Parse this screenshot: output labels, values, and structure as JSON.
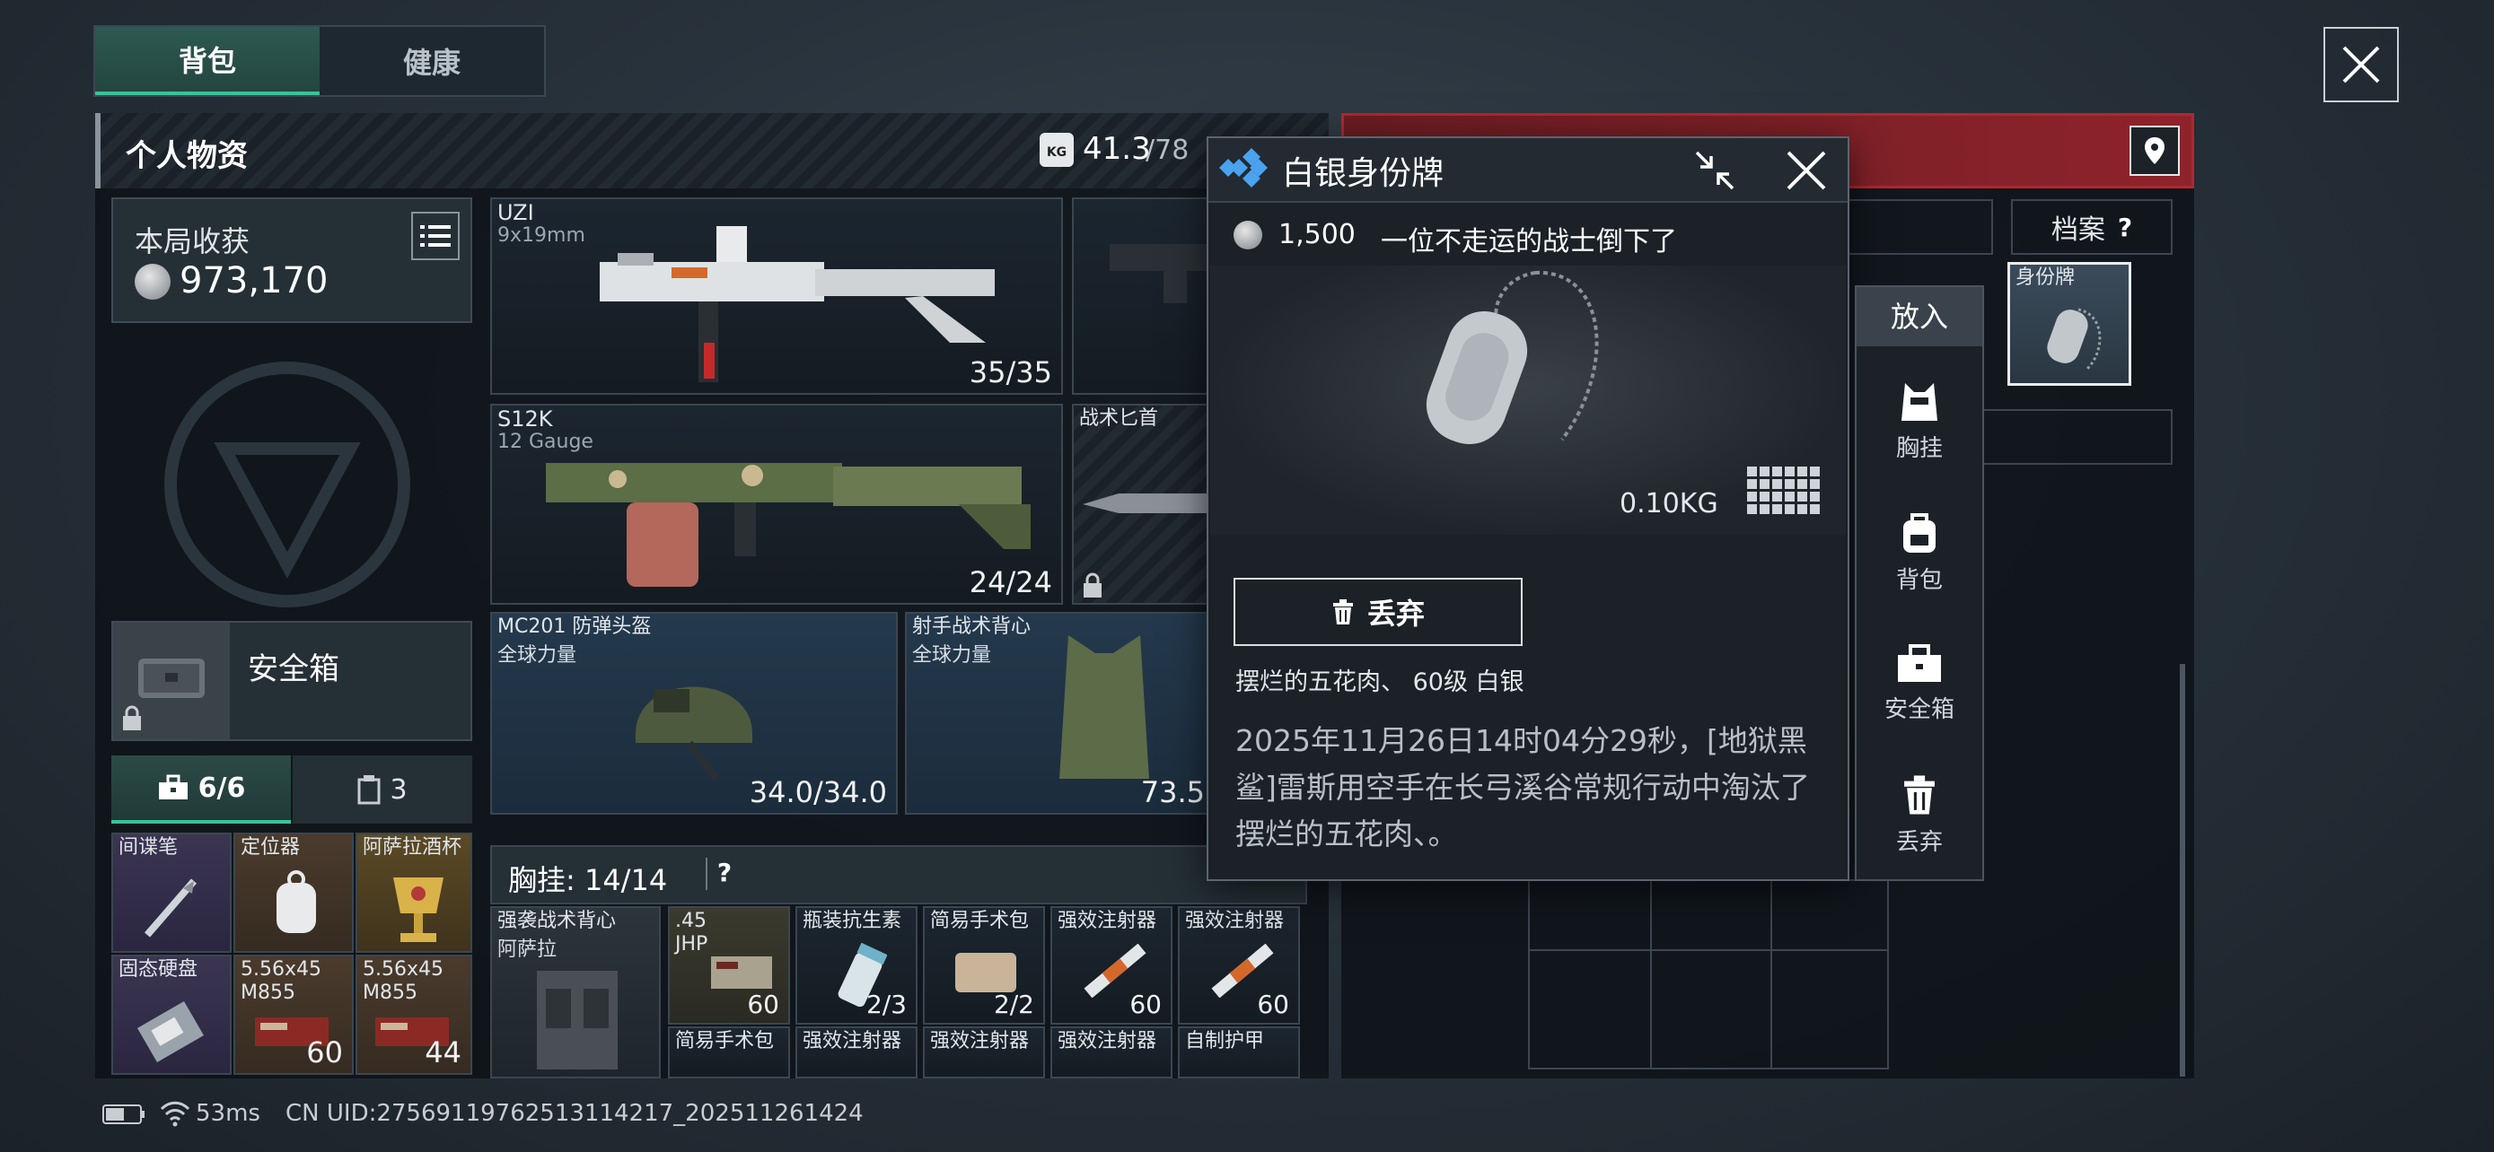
{
  "tabs": [
    "背包",
    "健康"
  ],
  "header": {
    "title": "个人物资",
    "weight": "41.3",
    "weight_max": "/78"
  },
  "earnings": {
    "label": "本局收获",
    "value": "973,170"
  },
  "safe_box": {
    "label": "安全箱"
  },
  "sub_tabs": {
    "tab1": "6/6",
    "tab2": "3"
  },
  "safe_items": [
    {
      "name": "间谍笔"
    },
    {
      "name": "定位器"
    },
    {
      "name": "阿萨拉酒杯"
    },
    {
      "name": "固态硬盘"
    },
    {
      "name": "5.56x45\nM855",
      "count": "60"
    },
    {
      "name": "5.56x45\nM855",
      "count": "44"
    }
  ],
  "weapons": [
    {
      "name": "UZI",
      "sub": "9x19mm",
      "ammo": "35/35"
    },
    {
      "name": "S12K",
      "sub": "12 Gauge",
      "ammo": "24/24"
    },
    {
      "name": "战术匕首"
    }
  ],
  "armor": [
    {
      "name": "MC201 防弹头盔",
      "sub": "全球力量",
      "durability": "34.0/34.0"
    },
    {
      "name": "射手战术背心",
      "sub": "全球力量",
      "durability": "73.5"
    }
  ],
  "rig": {
    "label": "胸挂: 14/14",
    "help": "?",
    "vest_name": "强袭战术背心",
    "vest_sub": "阿萨拉",
    "items": [
      {
        "name": ".45\nJHP",
        "count": "60"
      },
      {
        "name": "瓶装抗生素",
        "count": "2/3"
      },
      {
        "name": "简易手术包",
        "count": "2/2"
      },
      {
        "name": "强效注射器",
        "count": "60"
      },
      {
        "name": "强效注射器",
        "count": "60"
      }
    ],
    "row2": [
      "简易手术包",
      "强效注射器",
      "强效注射器",
      "强效注射器",
      "自制护甲"
    ]
  },
  "popup": {
    "title": "白银身份牌",
    "price": "1,500",
    "desc": "一位不走运的战士倒下了",
    "weight": "0.10KG",
    "discard": "丢弃",
    "owner": "摆烂的五花肉、 60级 白银",
    "story": "2025年11月26日14时04分29秒，[地狱黑鲨]雷斯用空手在长弓溪谷常规行动中淘汰了摆烂的五花肉、。"
  },
  "actions": {
    "put": "放入",
    "items": [
      "胸挂",
      "背包",
      "安全箱",
      "丢弃"
    ]
  },
  "right": {
    "archive": "档案",
    "help": "?",
    "tag_label": "身份牌"
  },
  "status": {
    "ping": "53ms",
    "uid": "CN UID:2756911976251311421​7_202511261424"
  },
  "colors": {
    "accent": "#39c29a",
    "red": "#b3262f"
  }
}
